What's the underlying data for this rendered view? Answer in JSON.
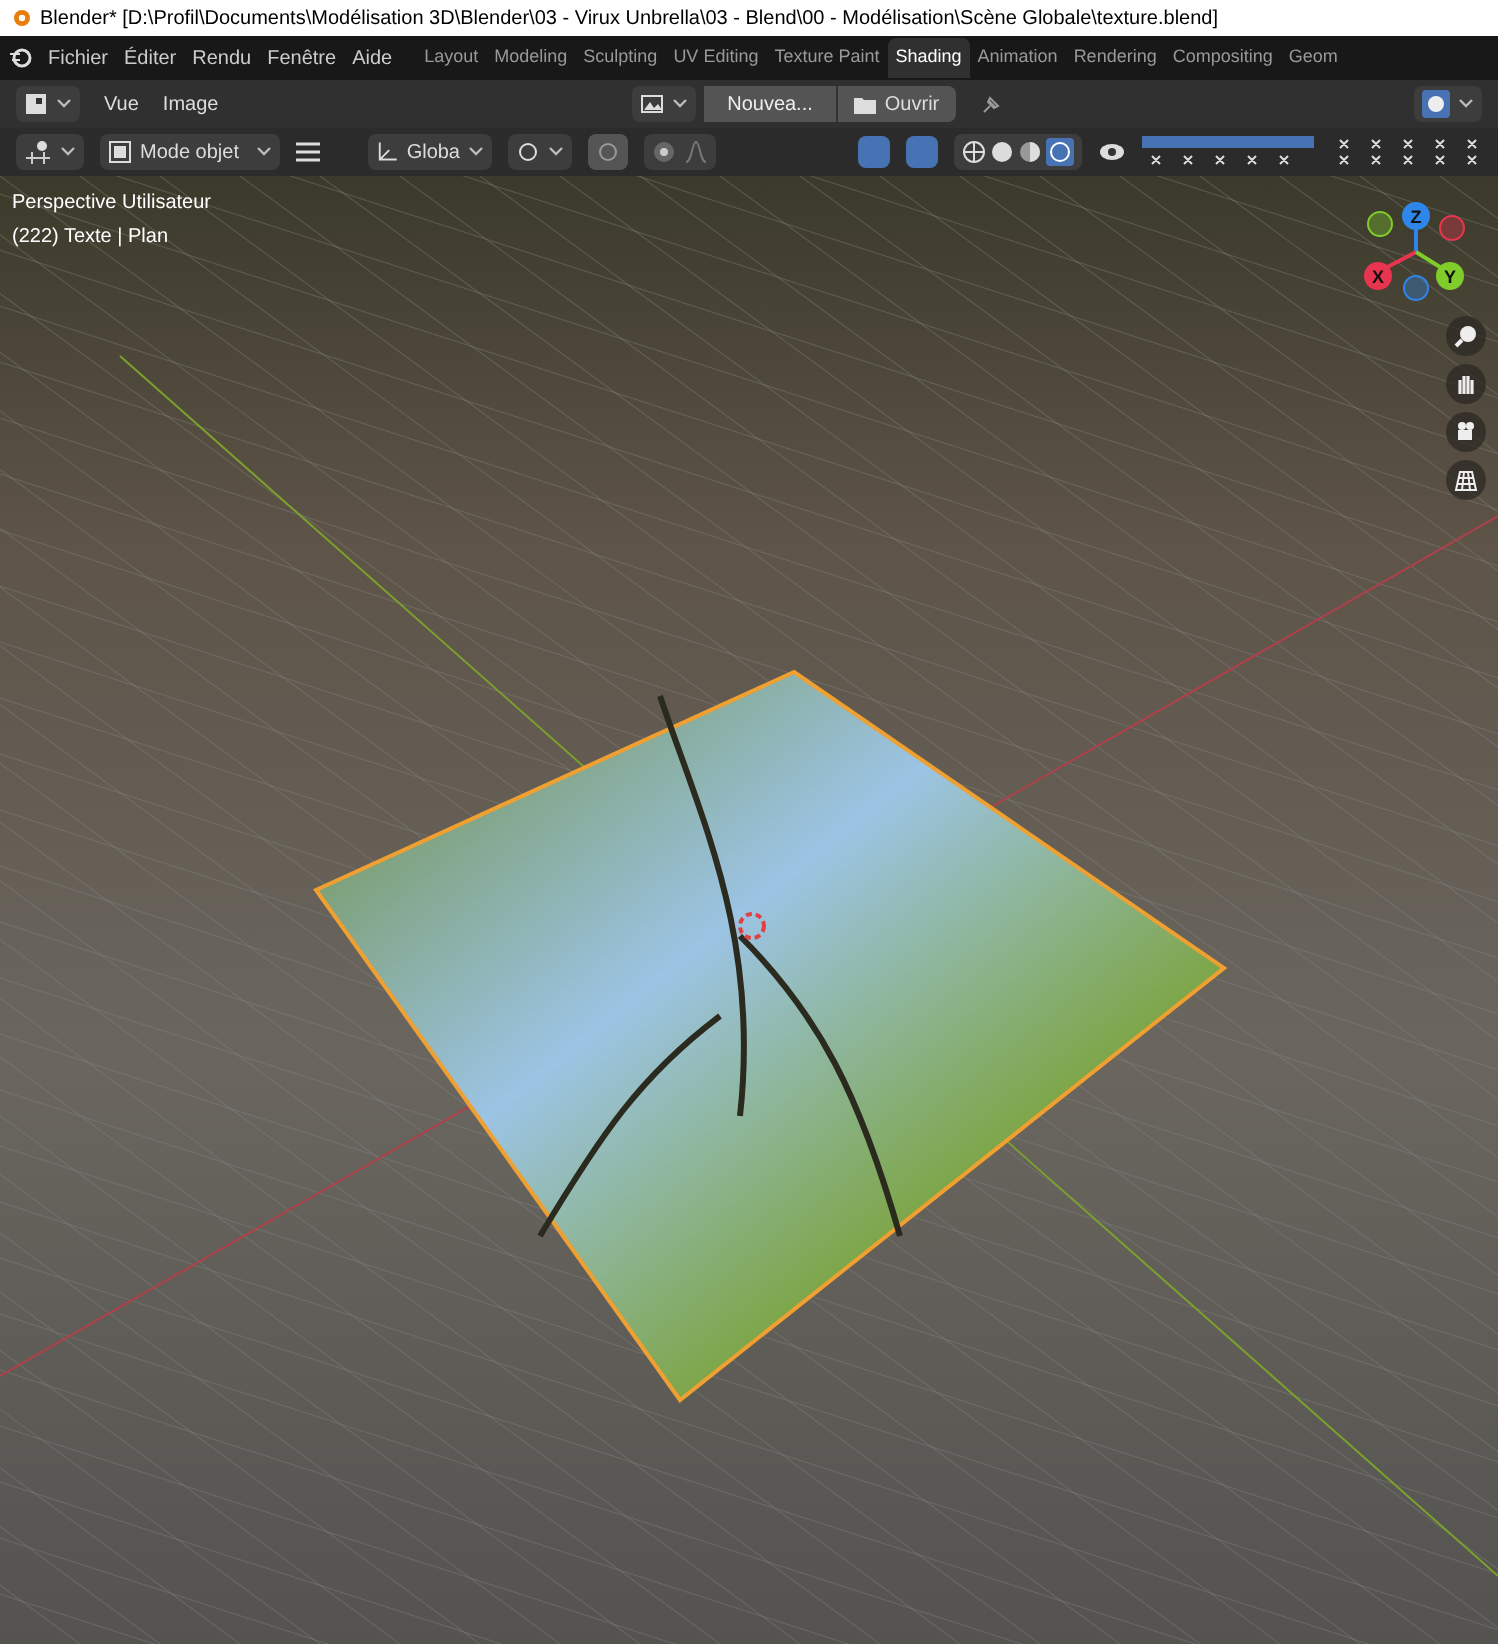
{
  "title_bar": {
    "title": "Blender* [D:\\Profil\\Documents\\Modélisation 3D\\Blender\\03 - Virux Unbrella\\03 - Blend\\00 - Modélisation\\Scène Globale\\texture.blend]"
  },
  "menu_bar": {
    "items": [
      "Fichier",
      "Éditer",
      "Rendu",
      "Fenêtre",
      "Aide"
    ]
  },
  "workspace_tabs": [
    {
      "label": "Layout",
      "selected": false
    },
    {
      "label": "Modeling",
      "selected": false
    },
    {
      "label": "Sculpting",
      "selected": false
    },
    {
      "label": "UV Editing",
      "selected": false
    },
    {
      "label": "Texture Paint",
      "selected": false
    },
    {
      "label": "Shading",
      "selected": true
    },
    {
      "label": "Animation",
      "selected": false
    },
    {
      "label": "Rendering",
      "selected": false
    },
    {
      "label": "Compositing",
      "selected": false
    },
    {
      "label": "Geom",
      "selected": false
    }
  ],
  "image_editor_header": {
    "menus": [
      "Vue",
      "Image"
    ],
    "new_button": "Nouvea...",
    "open_button": "Ouvrir"
  },
  "viewport_header": {
    "mode": "Mode objet",
    "orientation": "Globa"
  },
  "viewport": {
    "view_name": "Perspective Utilisateur",
    "object_info": "(222) Texte | Plan",
    "gizmo_axes": [
      "X",
      "Y",
      "Z"
    ]
  }
}
